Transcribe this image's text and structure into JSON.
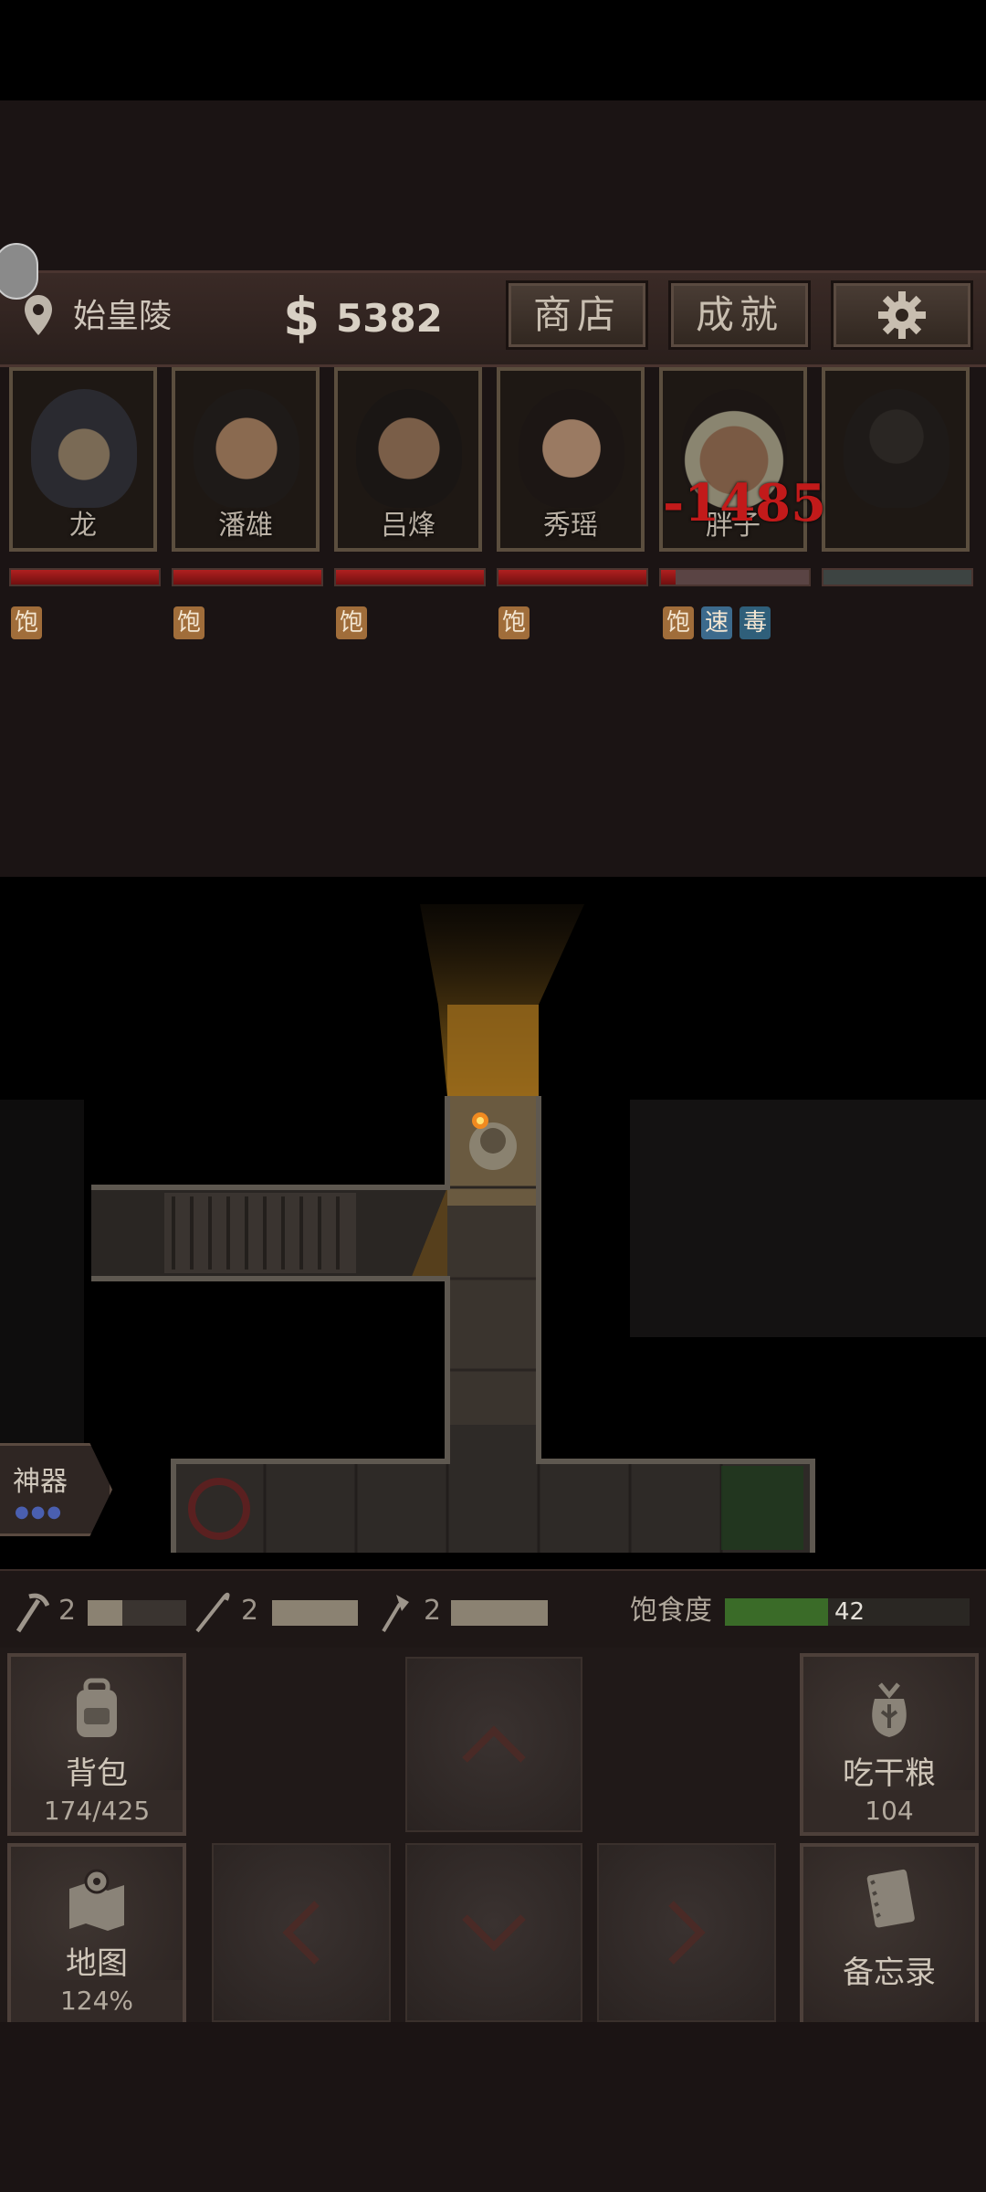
{
  "header": {
    "location": "始皇陵",
    "money_symbol": "$",
    "money": "5382",
    "shop_label": "商店",
    "achievements_label": "成就"
  },
  "party": [
    {
      "name": "龙",
      "hp_fraction": 1.0,
      "buffs": [
        "饱"
      ]
    },
    {
      "name": "潘雄",
      "hp_fraction": 1.0,
      "buffs": [
        "饱"
      ]
    },
    {
      "name": "吕烽",
      "hp_fraction": 1.0,
      "buffs": [
        "饱"
      ]
    },
    {
      "name": "秀瑶",
      "hp_fraction": 1.0,
      "buffs": [
        "饱"
      ]
    },
    {
      "name": "胖子",
      "hp_fraction": 0.1,
      "buffs": [
        "饱",
        "速",
        "毒"
      ]
    },
    {
      "name": "",
      "hp_fraction": 0.0,
      "buffs": []
    }
  ],
  "damage_popup": "-1485",
  "artifact": {
    "label": "神器",
    "dots": "●●●"
  },
  "tools": [
    {
      "icon": "pickaxe-icon",
      "count": "2",
      "durability": 0.35
    },
    {
      "icon": "rope-icon",
      "count": "2",
      "durability": 1.0
    },
    {
      "icon": "shovel-icon",
      "count": "2",
      "durability": 1.0
    }
  ],
  "hunger": {
    "label": "饱食度",
    "value": "42",
    "fraction": 0.42
  },
  "panel": {
    "backpack_label": "背包",
    "backpack_capacity": "174/425",
    "eat_label": "吃干粮",
    "eat_count": "104",
    "map_label": "地图",
    "map_percent": "124%",
    "memo_label": "备忘录"
  },
  "colors": {
    "hp": "#b02020",
    "hunger": "#3a6b28",
    "buff_full": "#a06d3a",
    "buff_speed": "#3c6a8c"
  }
}
